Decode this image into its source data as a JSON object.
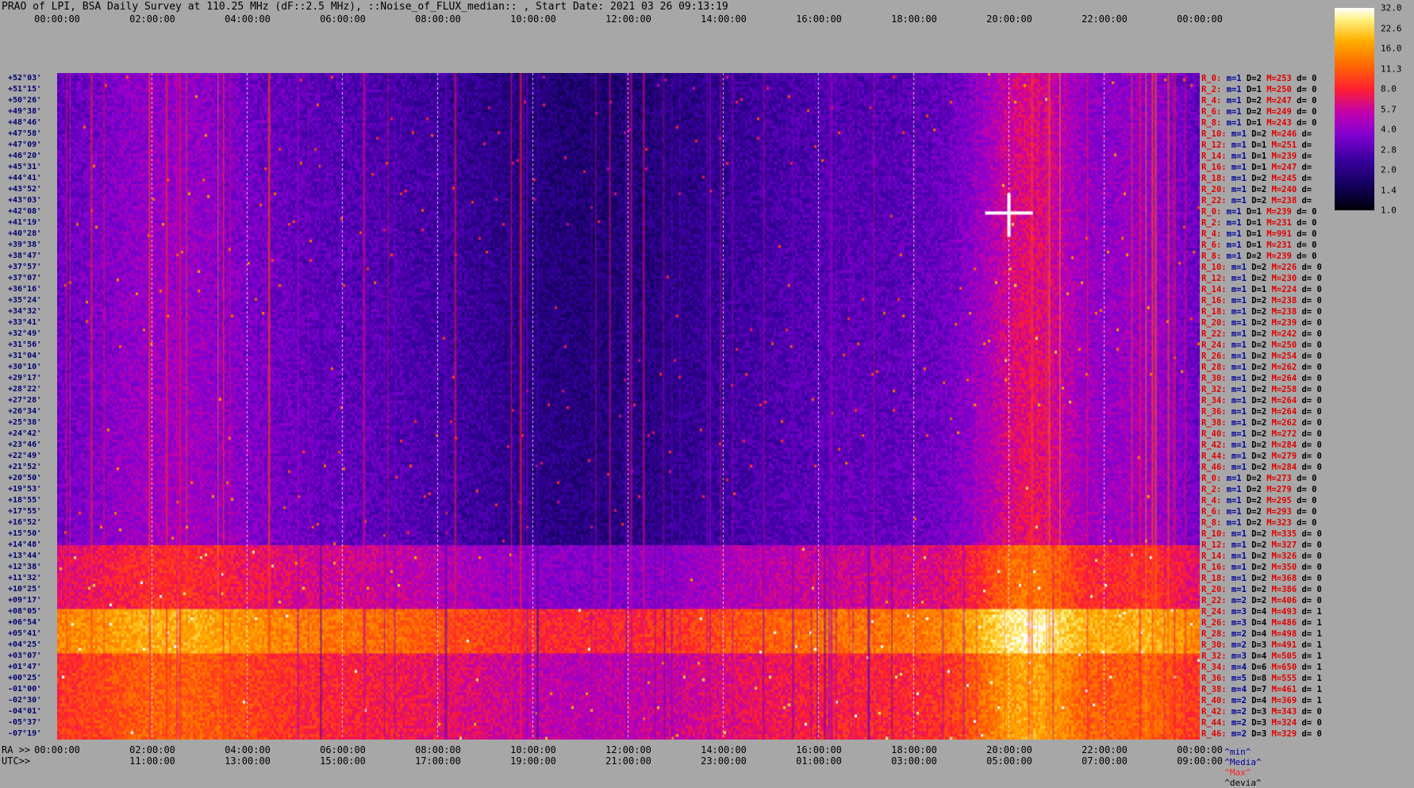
{
  "title": "PRAO of LPI, BSA Daily Survey at 110.25 MHz (dF::2.5 MHz), ::Noise_of_FLUX_median:: , Start Date: 2021 03 26 09:13:19",
  "axis_labels": {
    "ra": "RA >>",
    "utc": "UTC>>"
  },
  "top_ticks": [
    "00:00:00",
    "02:00:00",
    "04:00:00",
    "06:00:00",
    "08:00:00",
    "10:00:00",
    "12:00:00",
    "14:00:00",
    "16:00:00",
    "18:00:00",
    "20:00:00",
    "22:00:00",
    "00:00:00"
  ],
  "ra_ticks": [
    "00:00:00",
    "02:00:00",
    "04:00:00",
    "06:00:00",
    "08:00:00",
    "10:00:00",
    "12:00:00",
    "14:00:00",
    "16:00:00",
    "18:00:00",
    "20:00:00",
    "22:00:00",
    "00:00:00"
  ],
  "utc_ticks": [
    "11:00:00",
    "13:00:00",
    "15:00:00",
    "17:00:00",
    "19:00:00",
    "21:00:00",
    "23:00:00",
    "01:00:00",
    "03:00:00",
    "05:00:00",
    "07:00:00",
    "09:00:00"
  ],
  "legend": {
    "min": "^min^",
    "media": "^Media^",
    "max": "^Max^",
    "devia": "^devia^"
  },
  "colors": {
    "background": "#a7a7a7",
    "row_red": "#e00000",
    "row_blue": "#00009a",
    "max_label": "#ff2020"
  },
  "chart_data": {
    "type": "heatmap",
    "title": "PRAO of LPI, BSA Daily Survey at 110.25 MHz (dF::2.5 MHz), ::Noise_of_FLUX_median:: , Start Date: 2021 03 26 09:13:19",
    "x_axis": "RA 00:00:00 to 00:00:00 (UTC 09:13:19 start)",
    "colorbar": {
      "ticks": [
        "32.0",
        "22.6",
        "16.0",
        "11.3",
        "8.0",
        "5.7",
        "4.0",
        "2.8",
        "2.0",
        "1.4",
        "1.0"
      ],
      "scale": "log"
    },
    "rows": [
      {
        "dec": "+52°03'",
        "label": "R_0:",
        "m": "1",
        "D": "2",
        "M": "253",
        "d": "0"
      },
      {
        "dec": "+51°15'",
        "label": "R_2:",
        "m": "1",
        "D": "1",
        "M": "250",
        "d": "0"
      },
      {
        "dec": "+50°26'",
        "label": "R_4:",
        "m": "1",
        "D": "2",
        "M": "247",
        "d": "0"
      },
      {
        "dec": "+49°38'",
        "label": "R_6:",
        "m": "1",
        "D": "2",
        "M": "249",
        "d": "0"
      },
      {
        "dec": "+48°46'",
        "label": "R_8:",
        "m": "1",
        "D": "1",
        "M": "243",
        "d": "0"
      },
      {
        "dec": "+47°58'",
        "label": "R_10:",
        "m": "1",
        "D": "2",
        "M": "246",
        "d": ""
      },
      {
        "dec": "+47°09'",
        "label": "R_12:",
        "m": "1",
        "D": "1",
        "M": "251",
        "d": ""
      },
      {
        "dec": "+46°20'",
        "label": "R_14:",
        "m": "1",
        "D": "1",
        "M": "239",
        "d": ""
      },
      {
        "dec": "+45°31'",
        "label": "R_16:",
        "m": "1",
        "D": "1",
        "M": "247",
        "d": ""
      },
      {
        "dec": "+44°41'",
        "label": "R_18:",
        "m": "1",
        "D": "2",
        "M": "245",
        "d": ""
      },
      {
        "dec": "+43°52'",
        "label": "R_20:",
        "m": "1",
        "D": "2",
        "M": "240",
        "d": ""
      },
      {
        "dec": "+43°03'",
        "label": "R_22:",
        "m": "1",
        "D": "2",
        "M": "238",
        "d": ""
      },
      {
        "dec": "+42°08'",
        "label": "R_0:",
        "m": "1",
        "D": "1",
        "M": "239",
        "d": "0"
      },
      {
        "dec": "+41°19'",
        "label": "R_2:",
        "m": "1",
        "D": "1",
        "M": "231",
        "d": "0"
      },
      {
        "dec": "+40°28'",
        "label": "R_4:",
        "m": "1",
        "D": "1",
        "M": "991",
        "d": "0"
      },
      {
        "dec": "+39°38'",
        "label": "R_6:",
        "m": "1",
        "D": "1",
        "M": "231",
        "d": "0"
      },
      {
        "dec": "+38°47'",
        "label": "R_8:",
        "m": "1",
        "D": "2",
        "M": "239",
        "d": "0"
      },
      {
        "dec": "+37°57'",
        "label": "R_10:",
        "m": "1",
        "D": "2",
        "M": "226",
        "d": "0"
      },
      {
        "dec": "+37°07'",
        "label": "R_12:",
        "m": "1",
        "D": "2",
        "M": "230",
        "d": "0"
      },
      {
        "dec": "+36°16'",
        "label": "R_14:",
        "m": "1",
        "D": "1",
        "M": "224",
        "d": "0"
      },
      {
        "dec": "+35°24'",
        "label": "R_16:",
        "m": "1",
        "D": "2",
        "M": "238",
        "d": "0"
      },
      {
        "dec": "+34°32'",
        "label": "R_18:",
        "m": "1",
        "D": "2",
        "M": "238",
        "d": "0"
      },
      {
        "dec": "+33°41'",
        "label": "R_20:",
        "m": "1",
        "D": "2",
        "M": "239",
        "d": "0"
      },
      {
        "dec": "+32°49'",
        "label": "R_22:",
        "m": "1",
        "D": "2",
        "M": "242",
        "d": "0"
      },
      {
        "dec": "+31°56'",
        "label": "R_24:",
        "m": "1",
        "D": "2",
        "M": "250",
        "d": "0"
      },
      {
        "dec": "+31°04'",
        "label": "R_26:",
        "m": "1",
        "D": "2",
        "M": "254",
        "d": "0"
      },
      {
        "dec": "+30°10'",
        "label": "R_28:",
        "m": "1",
        "D": "2",
        "M": "262",
        "d": "0"
      },
      {
        "dec": "+29°17'",
        "label": "R_30:",
        "m": "1",
        "D": "2",
        "M": "264",
        "d": "0"
      },
      {
        "dec": "+28°22'",
        "label": "R_32:",
        "m": "1",
        "D": "2",
        "M": "258",
        "d": "0"
      },
      {
        "dec": "+27°28'",
        "label": "R_34:",
        "m": "1",
        "D": "2",
        "M": "264",
        "d": "0"
      },
      {
        "dec": "+26°34'",
        "label": "R_36:",
        "m": "1",
        "D": "2",
        "M": "264",
        "d": "0"
      },
      {
        "dec": "+25°38'",
        "label": "R_38:",
        "m": "1",
        "D": "2",
        "M": "262",
        "d": "0"
      },
      {
        "dec": "+24°42'",
        "label": "R_40:",
        "m": "1",
        "D": "2",
        "M": "272",
        "d": "0"
      },
      {
        "dec": "+23°46'",
        "label": "R_42:",
        "m": "1",
        "D": "2",
        "M": "284",
        "d": "0"
      },
      {
        "dec": "+22°49'",
        "label": "R_44:",
        "m": "1",
        "D": "2",
        "M": "279",
        "d": "0"
      },
      {
        "dec": "+21°52'",
        "label": "R_46:",
        "m": "1",
        "D": "2",
        "M": "284",
        "d": "0"
      },
      {
        "dec": "+20°50'",
        "label": "R_0:",
        "m": "1",
        "D": "2",
        "M": "273",
        "d": "0"
      },
      {
        "dec": "+19°53'",
        "label": "R_2:",
        "m": "1",
        "D": "2",
        "M": "279",
        "d": "0"
      },
      {
        "dec": "+18°55'",
        "label": "R_4:",
        "m": "1",
        "D": "2",
        "M": "295",
        "d": "0"
      },
      {
        "dec": "+17°55'",
        "label": "R_6:",
        "m": "1",
        "D": "2",
        "M": "293",
        "d": "0"
      },
      {
        "dec": "+16°52'",
        "label": "R_8:",
        "m": "1",
        "D": "2",
        "M": "323",
        "d": "0"
      },
      {
        "dec": "+15°50'",
        "label": "R_10:",
        "m": "1",
        "D": "2",
        "M": "335",
        "d": "0"
      },
      {
        "dec": "+14°48'",
        "label": "R_12:",
        "m": "1",
        "D": "2",
        "M": "327",
        "d": "0"
      },
      {
        "dec": "+13°44'",
        "label": "R_14:",
        "m": "1",
        "D": "2",
        "M": "326",
        "d": "0"
      },
      {
        "dec": "+12°38'",
        "label": "R_16:",
        "m": "1",
        "D": "2",
        "M": "350",
        "d": "0"
      },
      {
        "dec": "+11°32'",
        "label": "R_18:",
        "m": "1",
        "D": "2",
        "M": "368",
        "d": "0"
      },
      {
        "dec": "+10°25'",
        "label": "R_20:",
        "m": "1",
        "D": "2",
        "M": "386",
        "d": "0"
      },
      {
        "dec": "+09°17'",
        "label": "R_22:",
        "m": "2",
        "D": "2",
        "M": "406",
        "d": "0"
      },
      {
        "dec": "+08°05'",
        "label": "R_24:",
        "m": "3",
        "D": "4",
        "M": "493",
        "d": "1"
      },
      {
        "dec": "+06°54'",
        "label": "R_26:",
        "m": "3",
        "D": "4",
        "M": "486",
        "d": "1"
      },
      {
        "dec": "+05°41'",
        "label": "R_28:",
        "m": "2",
        "D": "4",
        "M": "498",
        "d": "1"
      },
      {
        "dec": "+04°25'",
        "label": "R_30:",
        "m": "2",
        "D": "3",
        "M": "491",
        "d": "1"
      },
      {
        "dec": "+03°07'",
        "label": "R_32:",
        "m": "3",
        "D": "4",
        "M": "505",
        "d": "1"
      },
      {
        "dec": "+01°47'",
        "label": "R_34:",
        "m": "4",
        "D": "6",
        "M": "650",
        "d": "1"
      },
      {
        "dec": "+00°25'",
        "label": "R_36:",
        "m": "5",
        "D": "8",
        "M": "555",
        "d": "1"
      },
      {
        "dec": "-01°00'",
        "label": "R_38:",
        "m": "4",
        "D": "7",
        "M": "461",
        "d": "1"
      },
      {
        "dec": "-02°30'",
        "label": "R_40:",
        "m": "2",
        "D": "4",
        "M": "369",
        "d": "1"
      },
      {
        "dec": "-04°01'",
        "label": "R_42:",
        "m": "2",
        "D": "3",
        "M": "343",
        "d": "0"
      },
      {
        "dec": "-05°37'",
        "label": "R_44:",
        "m": "2",
        "D": "3",
        "M": "324",
        "d": "0"
      },
      {
        "dec": "-07°19'",
        "label": "R_46:",
        "m": "2",
        "D": "3",
        "M": "329",
        "d": "0"
      }
    ]
  }
}
